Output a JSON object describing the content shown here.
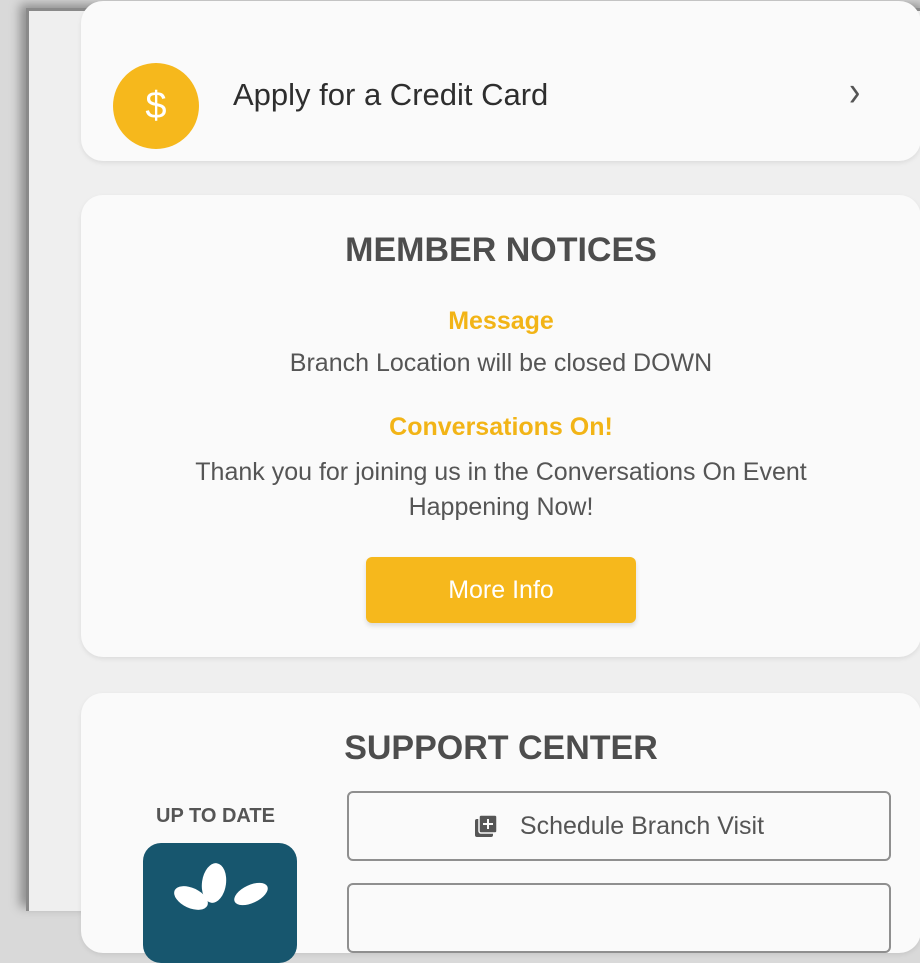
{
  "credit": {
    "label": "Apply for a Credit Card",
    "icon": "dollar-icon",
    "chevron_icon": "chevron-right-icon"
  },
  "notices": {
    "title": "MEMBER NOTICES",
    "items": [
      {
        "title": "Message",
        "text": "Branch Location will be closed DOWN"
      },
      {
        "title": "Conversations On!",
        "text": "Thank you for joining us in the Conversations On Event Happening Now!"
      }
    ],
    "button": "More Info"
  },
  "support": {
    "title": "SUPPORT CENTER",
    "side_label": "UP TO DATE",
    "buttons": [
      {
        "label": "Schedule Branch Visit",
        "icon": "add-calendar-icon"
      }
    ]
  },
  "colors": {
    "accent": "#f6b81c",
    "tile": "#17566e"
  }
}
